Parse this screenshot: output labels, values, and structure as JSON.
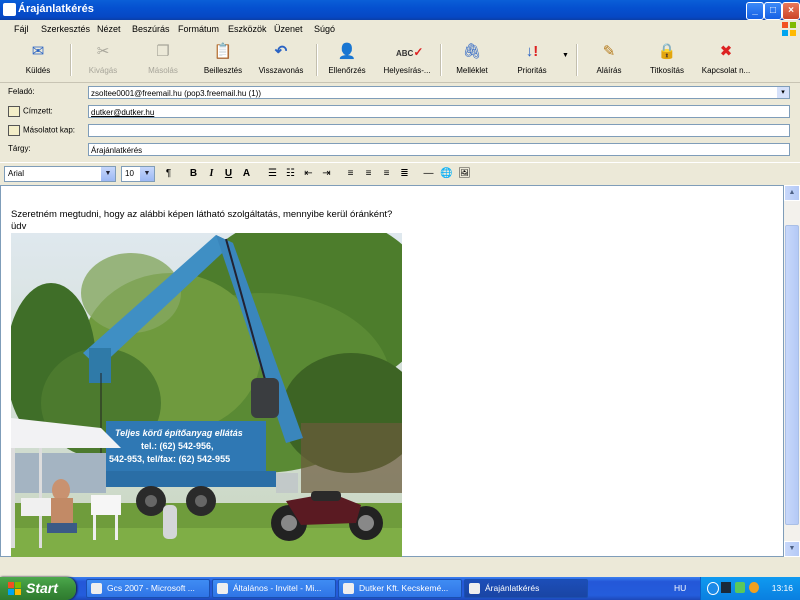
{
  "window": {
    "title": "Árajánlatkérés"
  },
  "menu": [
    "Fájl",
    "Szerkesztés",
    "Nézet",
    "Beszúrás",
    "Formátum",
    "Eszközök",
    "Üzenet",
    "Súgó"
  ],
  "toolbar": {
    "send": "Küldés",
    "cut": "Kivágás",
    "copy": "Másolás",
    "paste": "Beillesztés",
    "undo": "Visszavonás",
    "check": "Ellenőrzés",
    "spelling": "Helyesírás-...",
    "attach": "Melléklet",
    "priority": "Prioritás",
    "sign": "Aláírás",
    "encrypt": "Titkosítás",
    "offline": "Kapcsolat n..."
  },
  "headers": {
    "from_label": "Feladó:",
    "from_value": "zsoltee0001@freemail.hu    (pop3.freemail.hu (1))",
    "to_label": "Címzett:",
    "to_value": "dutker@dutker.hu",
    "cc_label": "Másolatot kap:",
    "cc_value": "",
    "subject_label": "Tárgy:",
    "subject_value": "Árajánlatkérés"
  },
  "format": {
    "font": "Arial",
    "size": "10"
  },
  "body": {
    "line1": "Szeretném megtudni, hogy az alábbi képen látható szolgáltatás, mennyibe kerül óránként?",
    "line2": "üdv",
    "truck_sign_1": "Teljes körű építőanyag ellátás",
    "truck_sign_2": "tel.: (62) 542-956,",
    "truck_sign_3": "542-953, tel/fax: (62) 542-955"
  },
  "taskbar": {
    "start": "Start",
    "tasks": [
      "Gcs 2007 - Microsoft ...",
      "Általános - Invitel - Mi...",
      "Dutker Kft. Kecskemé...",
      "Árajánlatkérés"
    ],
    "language": "HU",
    "clock": "13:16"
  },
  "colors": {
    "titlebar": "#0550d0",
    "taskbar": "#245ddc",
    "start": "#3a8e3a"
  }
}
